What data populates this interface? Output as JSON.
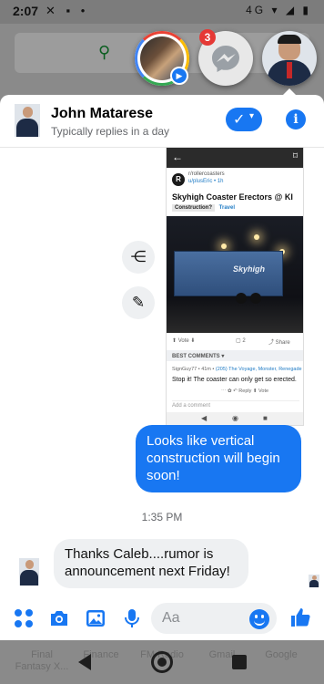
{
  "status_bar": {
    "time": "2:07",
    "left_icons": "✕ ▪ •",
    "network": "4G",
    "right_icons": "▾ ◢ ▮"
  },
  "chat_heads": {
    "unread_badge": "3"
  },
  "header": {
    "name": "John Matarese",
    "subtitle": "Typically replies in a day",
    "check_glyph": "✓",
    "chevron_glyph": "▾",
    "info_glyph": "i"
  },
  "shared_post": {
    "back_glyph": "←",
    "bookmark_glyph": "⌑",
    "logo_letter": "R",
    "subreddit": "r/rollercoasters",
    "author": "u/plusEric • 1h",
    "title": "Skyhigh Coaster Erectors @ KI",
    "tag1": "Construction?",
    "tag2": "Travel",
    "trailer_text": "Skyhigh",
    "vote": "⬆ Vote ⬇",
    "comments": "▢ 2",
    "share": "⤴ Share",
    "best_comments": "BEST COMMENTS ▾",
    "comment_user": "SignGuy77 • 41m •",
    "comment_flair": "(205) The Voyage, Monster, Renegade",
    "comment_text": "Stop it! The coaster can only get so erected.",
    "comment_actions": "⋯   ✿   ↶ Reply   ⬆ Vote",
    "add_comment": "Add a comment",
    "nav_back": "◀",
    "nav_home": "◉",
    "nav_recent": "■"
  },
  "side_actions": {
    "share_glyph": "⋲",
    "edit_glyph": "✎"
  },
  "messages": [
    {
      "from": "me",
      "text": "Looks like vertical construction will begin soon!"
    },
    {
      "from": "them",
      "text": "Thanks Caleb....rumor is announcement next Friday!"
    }
  ],
  "timestamp": "1:35 PM",
  "composer": {
    "placeholder": "Aa",
    "thumbs_glyph": "👍"
  },
  "dock": {
    "apps": [
      "Final Fantasy X...",
      "Finance",
      "FM Radio",
      "Gmail",
      "Google"
    ]
  },
  "colors": {
    "accent": "#1877f2",
    "dim": "#8a8a8a"
  }
}
